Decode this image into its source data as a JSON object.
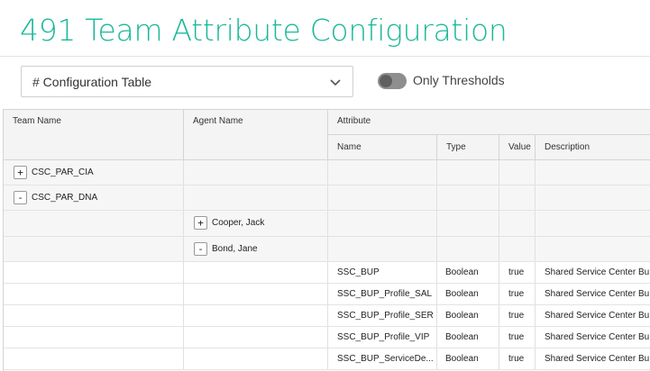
{
  "page": {
    "title": "491 Team Attribute Configuration"
  },
  "dropdown": {
    "value": "# Configuration Table",
    "icon": "chevron-down-icon"
  },
  "toggle": {
    "label": "Only Thresholds",
    "on": false
  },
  "table": {
    "headers": {
      "team_name": "Team Name",
      "agent_name": "Agent Name",
      "attribute": "Attribute",
      "name": "Name",
      "type": "Type",
      "value": "Value",
      "description": "Description"
    },
    "teams": [
      {
        "expander": "+",
        "name": "CSC_PAR_CIA"
      },
      {
        "expander": "-",
        "name": "CSC_PAR_DNA"
      }
    ],
    "agents": [
      {
        "expander": "+",
        "name": "Cooper, Jack"
      },
      {
        "expander": "-",
        "name": "Bond, Jane"
      }
    ],
    "attributes": [
      {
        "name": "SSC_BUP",
        "type": "Boolean",
        "value": "true",
        "description": "Shared Service Center Bu"
      },
      {
        "name": "SSC_BUP_Profile_SAL",
        "type": "Boolean",
        "value": "true",
        "description": "Shared Service Center Bu"
      },
      {
        "name": "SSC_BUP_Profile_SER",
        "type": "Boolean",
        "value": "true",
        "description": "Shared Service Center Bu"
      },
      {
        "name": "SSC_BUP_Profile_VIP",
        "type": "Boolean",
        "value": "true",
        "description": "Shared Service Center Bu"
      },
      {
        "name": "SSC_BUP_ServiceDe...",
        "type": "Boolean",
        "value": "true",
        "description": "Shared Service Center Bu"
      }
    ]
  }
}
